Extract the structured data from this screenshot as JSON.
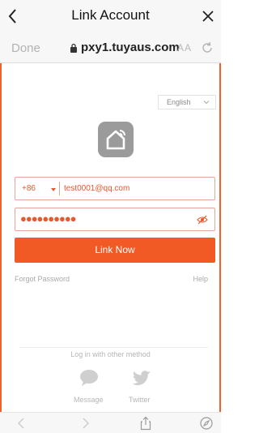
{
  "titlebar": {
    "title": "Link Account"
  },
  "addressbar": {
    "done_label": "Done",
    "url": "pxy1.tuyaus.com",
    "text_size_label": "AA"
  },
  "form": {
    "language": "English",
    "country_code": "+86",
    "account": "test0001@qq.com",
    "password_mask": "●●●●●●●●●●",
    "link_button": "Link Now",
    "forgot_password": "Forgot Password",
    "help": "Help"
  },
  "other_login": {
    "heading": "Log in with other method",
    "methods": [
      {
        "label": "Message",
        "icon": "message-icon"
      },
      {
        "label": "Twitter",
        "icon": "twitter-icon"
      }
    ]
  },
  "colors": {
    "accent": "#f15a24",
    "logo_bg": "#9b9b9b"
  }
}
